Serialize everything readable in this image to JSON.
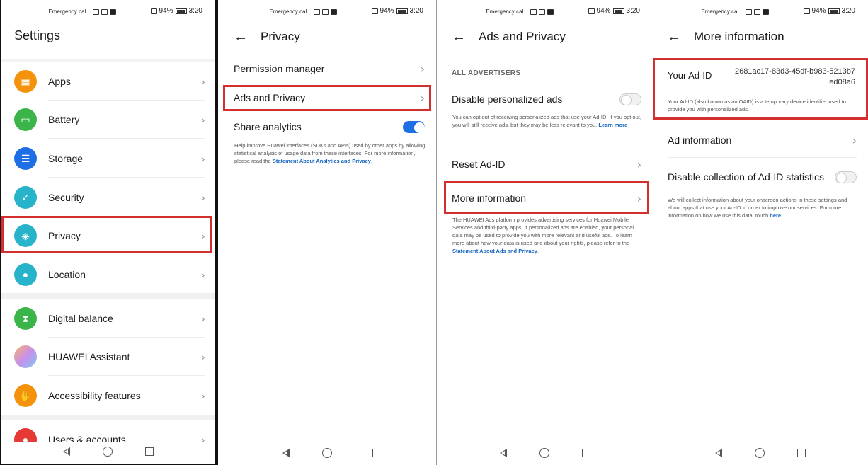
{
  "status_bar": {
    "left_text": "Emergency cal...",
    "battery": "94%",
    "time": "3:20"
  },
  "screen1": {
    "title": "Settings",
    "items": [
      {
        "label": "Apps",
        "icon": "apps-grid-icon",
        "color": "#f5920c"
      },
      {
        "label": "Battery",
        "icon": "battery-icon",
        "color": "#3bb54a"
      },
      {
        "label": "Storage",
        "icon": "storage-icon",
        "color": "#1e6fe6"
      },
      {
        "label": "Security",
        "icon": "shield-check-icon",
        "color": "#27b3c9"
      },
      {
        "label": "Privacy",
        "icon": "privacy-shield-icon",
        "color": "#27b3c9"
      },
      {
        "label": "Location",
        "icon": "location-pin-icon",
        "color": "#27b3c9"
      },
      {
        "label": "Digital balance",
        "icon": "hourglass-icon",
        "color": "#3bb54a"
      },
      {
        "label": "HUAWEI Assistant",
        "icon": "huawei-assistant-icon",
        "color": "#c98fe8"
      },
      {
        "label": "Accessibility features",
        "icon": "hand-icon",
        "color": "#f5920c"
      },
      {
        "label": "Users & accounts",
        "icon": "user-icon",
        "color": "#e53935"
      }
    ]
  },
  "screen2": {
    "title": "Privacy",
    "permission_manager": "Permission manager",
    "ads_and_privacy": "Ads and Privacy",
    "share_analytics": "Share analytics",
    "share_analytics_on": true,
    "analytics_desc": "Help improve Huawei interfaces (SDKs and APIs) used by other apps by allowing statistical analysis of usage data from these interfaces. For more information, please read the",
    "analytics_link": "Statement About Analytics and Privacy",
    "analytics_end": "."
  },
  "screen3": {
    "title": "Ads and Privacy",
    "section": "ALL ADVERTISERS",
    "disable_personalized": "Disable personalized ads",
    "disable_personalized_on": false,
    "personalized_desc": "You can opt out of receiving personalized ads that use your Ad-ID. If you opt out, you will still receive ads, but they may be less relevant to you.",
    "learn_more": "Learn more",
    "reset_ad_id": "Reset Ad-ID",
    "more_information": "More information",
    "platform_desc": "The HUAWEI Ads platform provides advertising services for Huawei Mobile Services and third-party apps. If personalized ads are enabled, your personal data may be used to provide you with more relevant and useful ads. To learn more about how your data is used and about your rights, please refer to the",
    "platform_link": "Statement About Ads and Privacy",
    "platform_end": "."
  },
  "screen4": {
    "title": "More information",
    "your_ad_id": "Your Ad-ID",
    "ad_id_line1": "2681ac17-83d3-45df-b983-5213b7",
    "ad_id_line2": "ed08a6",
    "ad_id_desc": "Your Ad-ID (also known as an OAID) is a temporary device identifier used to provide you with personalized ads.",
    "ad_information": "Ad information",
    "disable_collection": "Disable collection of Ad-ID statistics",
    "disable_collection_on": false,
    "collection_desc": "We will collect information about your onscreen actions in these settings and about apps that use your Ad-ID in order to improve our services. For more information on how we use this data, touch",
    "here": "here",
    "collection_end": "."
  },
  "accent": "#1e6fe6",
  "highlight": "#d32f2f"
}
